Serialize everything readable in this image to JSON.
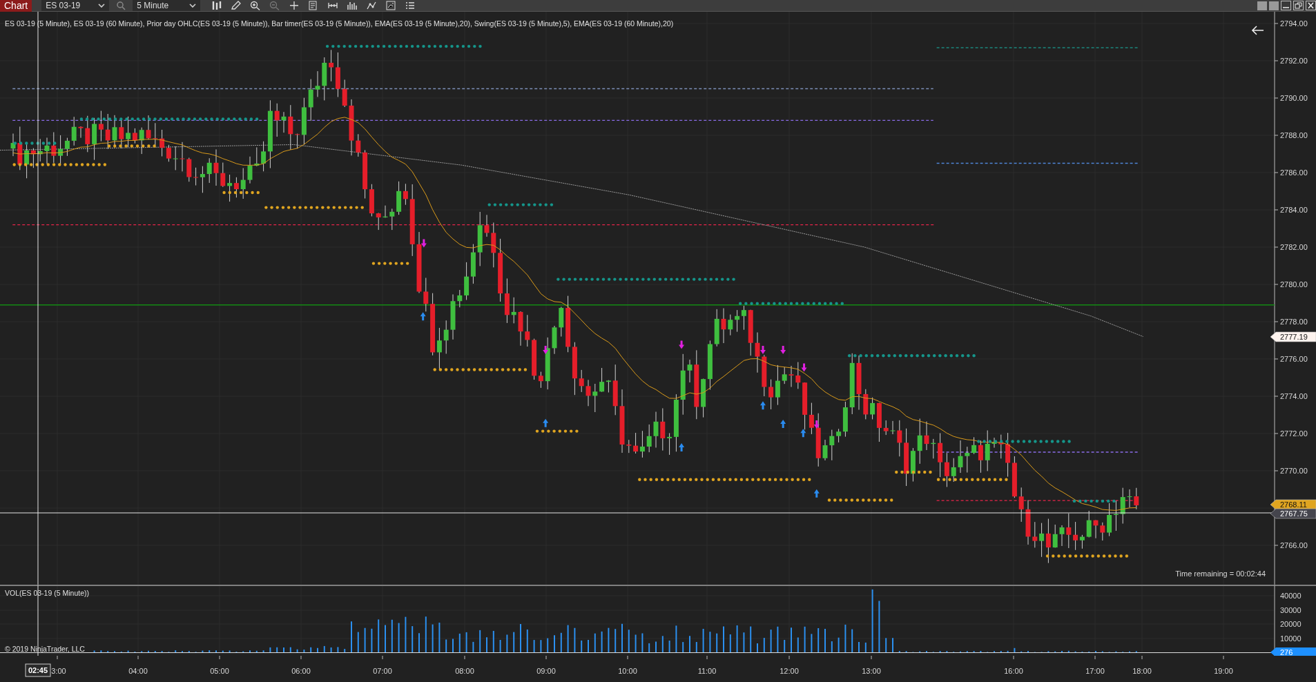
{
  "toolbar": {
    "tab": {
      "label": "Chart",
      "selected": true
    },
    "instrument": "ES 03-19",
    "interval": "5 Minute"
  },
  "chart": {
    "legend": "ES 03-19 (5 Minute), ES 03-19 (60 Minute), Prior day OHLC(ES 03-19 (5 Minute)), Bar timer(ES 03-19 (5 Minute)), EMA(ES 03-19 (5 Minute),20), Swing(ES 03-19 (5 Minute),5), EMA(ES 03-19 (60 Minute),20)",
    "price_labels": [
      "2794.00",
      "2792.00",
      "2790.00",
      "2788.00",
      "2786.00",
      "2784.00",
      "2782.00",
      "2780.00",
      "2778.00",
      "2776.00",
      "2774.00",
      "2772.00",
      "2770.00",
      "2766.00"
    ],
    "price_markers": [
      {
        "label": "2777.19",
        "color": "#fdf3ee"
      },
      {
        "label": "2768.11",
        "color": "#e0a520"
      },
      {
        "label": "2767.75",
        "color": "#45454d"
      }
    ],
    "time_remaining": "Time remaining = 00:02:44"
  },
  "volume": {
    "title": "VOL(ES 03-19 (5 Minute))",
    "axis_labels": [
      "40000",
      "30000",
      "20000",
      "10000"
    ],
    "marker": {
      "label": "276",
      "color": "#1e90ff"
    },
    "copyright": "© 2019 NinjaTrader, LLC"
  },
  "time_axis": {
    "labels": [
      "3:00",
      "04:00",
      "05:00",
      "06:00",
      "07:00",
      "08:00",
      "09:00",
      "10:00",
      "11:00",
      "12:00",
      "13:00",
      "16:00",
      "17:00",
      "18:00",
      "19:00"
    ],
    "crosshair": "02:45"
  }
}
